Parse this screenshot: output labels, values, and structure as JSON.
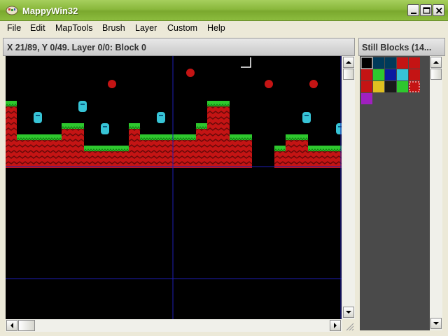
{
  "window": {
    "title": "MappyWin32",
    "accent": "#8ab83c"
  },
  "title_buttons": [
    "minimize-icon",
    "maximize-icon",
    "close-icon"
  ],
  "menu": [
    {
      "label": "File"
    },
    {
      "label": "Edit"
    },
    {
      "label": "MapTools"
    },
    {
      "label": "Brush"
    },
    {
      "label": "Layer"
    },
    {
      "label": "Custom"
    },
    {
      "label": "Help"
    }
  ],
  "map_view": {
    "status": "X 21/89, Y 0/49. Layer 0/0: Block 0",
    "background": "#000000",
    "grid_color": "#1e1eb4"
  },
  "blocks_panel": {
    "title": "Still Blocks (14...",
    "background": "#4a4a4a"
  }
}
